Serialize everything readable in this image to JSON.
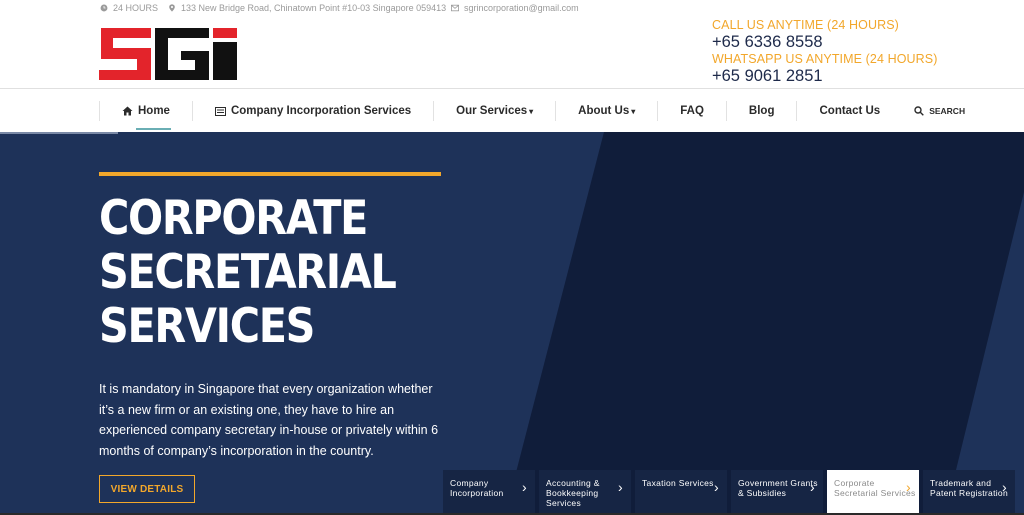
{
  "topbar": {
    "hours": "24 HOURS",
    "address": "133 New Bridge Road, Chinatown Point #10-03 Singapore 059413",
    "email": "sgrincorporation@gmail.com"
  },
  "logo": {
    "text": "SGI"
  },
  "contact": {
    "call_label": "CALL US ANYTIME (24 HOURS)",
    "call_number": "+65 6336 8558",
    "whatsapp_label": "WHATSAPP US ANYTIME (24 HOURS)",
    "whatsapp_number": "+65 9061 2851"
  },
  "nav": {
    "home": "Home",
    "incorporation": "Company Incorporation Services",
    "services": "Our Services",
    "about": "About Us",
    "faq": "FAQ",
    "blog": "Blog",
    "contact": "Contact Us",
    "search": "SEARCH"
  },
  "hero": {
    "title_line1": "CORPORATE",
    "title_line2": "SECRETARIAL",
    "title_line3": "SERVICES",
    "description": "It is mandatory in Singapore that every organization whether it’s a new firm or an existing one, they have to hire an experienced company secretary in-house or privately within 6 months of company’s incorporation in the country.",
    "button": "VIEW DETAILS"
  },
  "tabs": [
    {
      "label": "Company Incorporation"
    },
    {
      "label": "Accounting & Bookkeeping Services"
    },
    {
      "label": "Taxation Services"
    },
    {
      "label": "Government Grants & Subsidies"
    },
    {
      "label": "Corporate Secretarial Services",
      "active": true
    },
    {
      "label": "Trademark and Patent Registration"
    }
  ],
  "colors": {
    "accent": "#f2a72b",
    "navy": "#1e3259",
    "dark_navy": "#162544",
    "logo_red": "#e3242b"
  }
}
